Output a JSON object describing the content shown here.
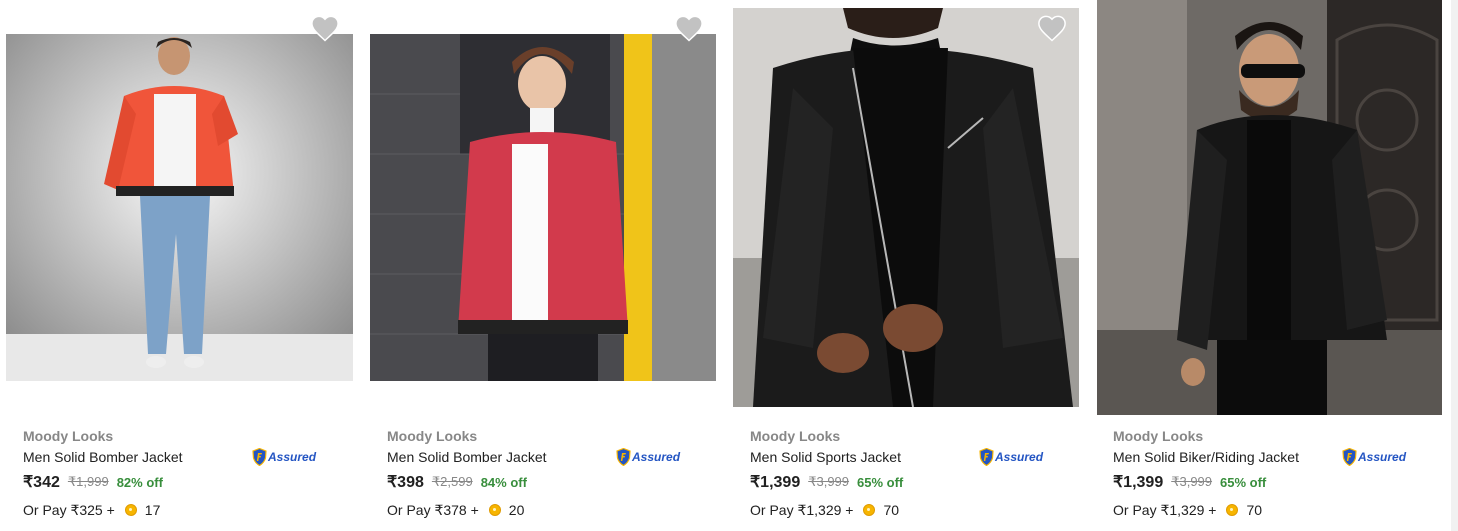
{
  "products": [
    {
      "brand": "Moody Looks",
      "title": "Men Solid Bomber Jacket",
      "assured_label": "Assured",
      "price": "₹342",
      "mrp": "₹1,999",
      "discount": "82% off",
      "pay_prefix": "Or Pay ₹325 +",
      "coins": "17",
      "jacket_color": "#f0553a"
    },
    {
      "brand": "Moody Looks",
      "title": "Men Solid Bomber Jacket",
      "assured_label": "Assured",
      "price": "₹398",
      "mrp": "₹2,599",
      "discount": "84% off",
      "pay_prefix": "Or Pay ₹378 +",
      "coins": "20",
      "jacket_color": "#d23a4c"
    },
    {
      "brand": "Moody Looks",
      "title": "Men Solid Sports Jacket",
      "assured_label": "Assured",
      "price": "₹1,399",
      "mrp": "₹3,999",
      "discount": "65% off",
      "pay_prefix": "Or Pay ₹1,329 +",
      "coins": "70",
      "jacket_color": "#1b1b1b"
    },
    {
      "brand": "Moody Looks",
      "title": "Men Solid Biker/Riding Jacket",
      "assured_label": "Assured",
      "price": "₹1,399",
      "mrp": "₹3,999",
      "discount": "65% off",
      "pay_prefix": "Or Pay ₹1,329 +",
      "coins": "70",
      "jacket_color": "#161616"
    }
  ],
  "colors": {
    "discount": "#388e3c",
    "assured": "#2455c3",
    "brand_text": "#878787",
    "wishlist_heart": "#c2c2c2"
  }
}
